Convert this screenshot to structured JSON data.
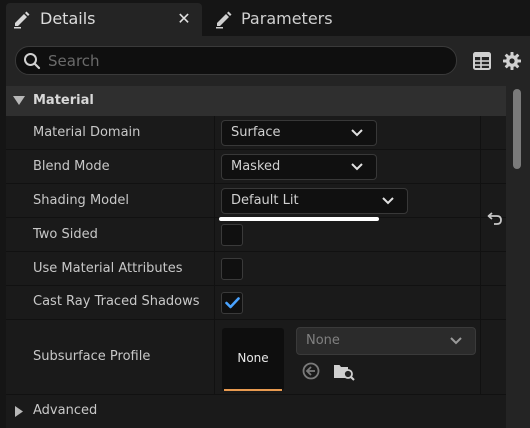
{
  "tabs": [
    {
      "label": "Details",
      "active": true,
      "icon": "pencil-icon",
      "close": "✕"
    },
    {
      "label": "Parameters",
      "active": false,
      "icon": "pencil-icon"
    }
  ],
  "search": {
    "placeholder": "Search",
    "value": ""
  },
  "toolbar": {
    "icons": [
      "table-view-icon",
      "settings-gear-icon"
    ]
  },
  "category": {
    "label": "Material",
    "expanded": true
  },
  "properties": {
    "material_domain": {
      "label": "Material Domain",
      "value": "Surface"
    },
    "blend_mode": {
      "label": "Blend Mode",
      "value": "Masked",
      "modified": true
    },
    "shading_model": {
      "label": "Shading Model",
      "value": "Default Lit"
    },
    "two_sided": {
      "label": "Two Sided",
      "checked": false
    },
    "use_material_attributes": {
      "label": "Use Material Attributes",
      "checked": false
    },
    "cast_ray_traced_shadows": {
      "label": "Cast Ray Traced Shadows",
      "checked": true
    },
    "subsurface_profile": {
      "label": "Subsurface Profile",
      "thumbnail": "None",
      "asset": "None"
    }
  },
  "advanced": {
    "label": "Advanced",
    "expanded": false
  },
  "colors": {
    "accent": "#4aa3ff",
    "thumbnail_bar": "#e89a50",
    "highlight": "#ffffff"
  }
}
